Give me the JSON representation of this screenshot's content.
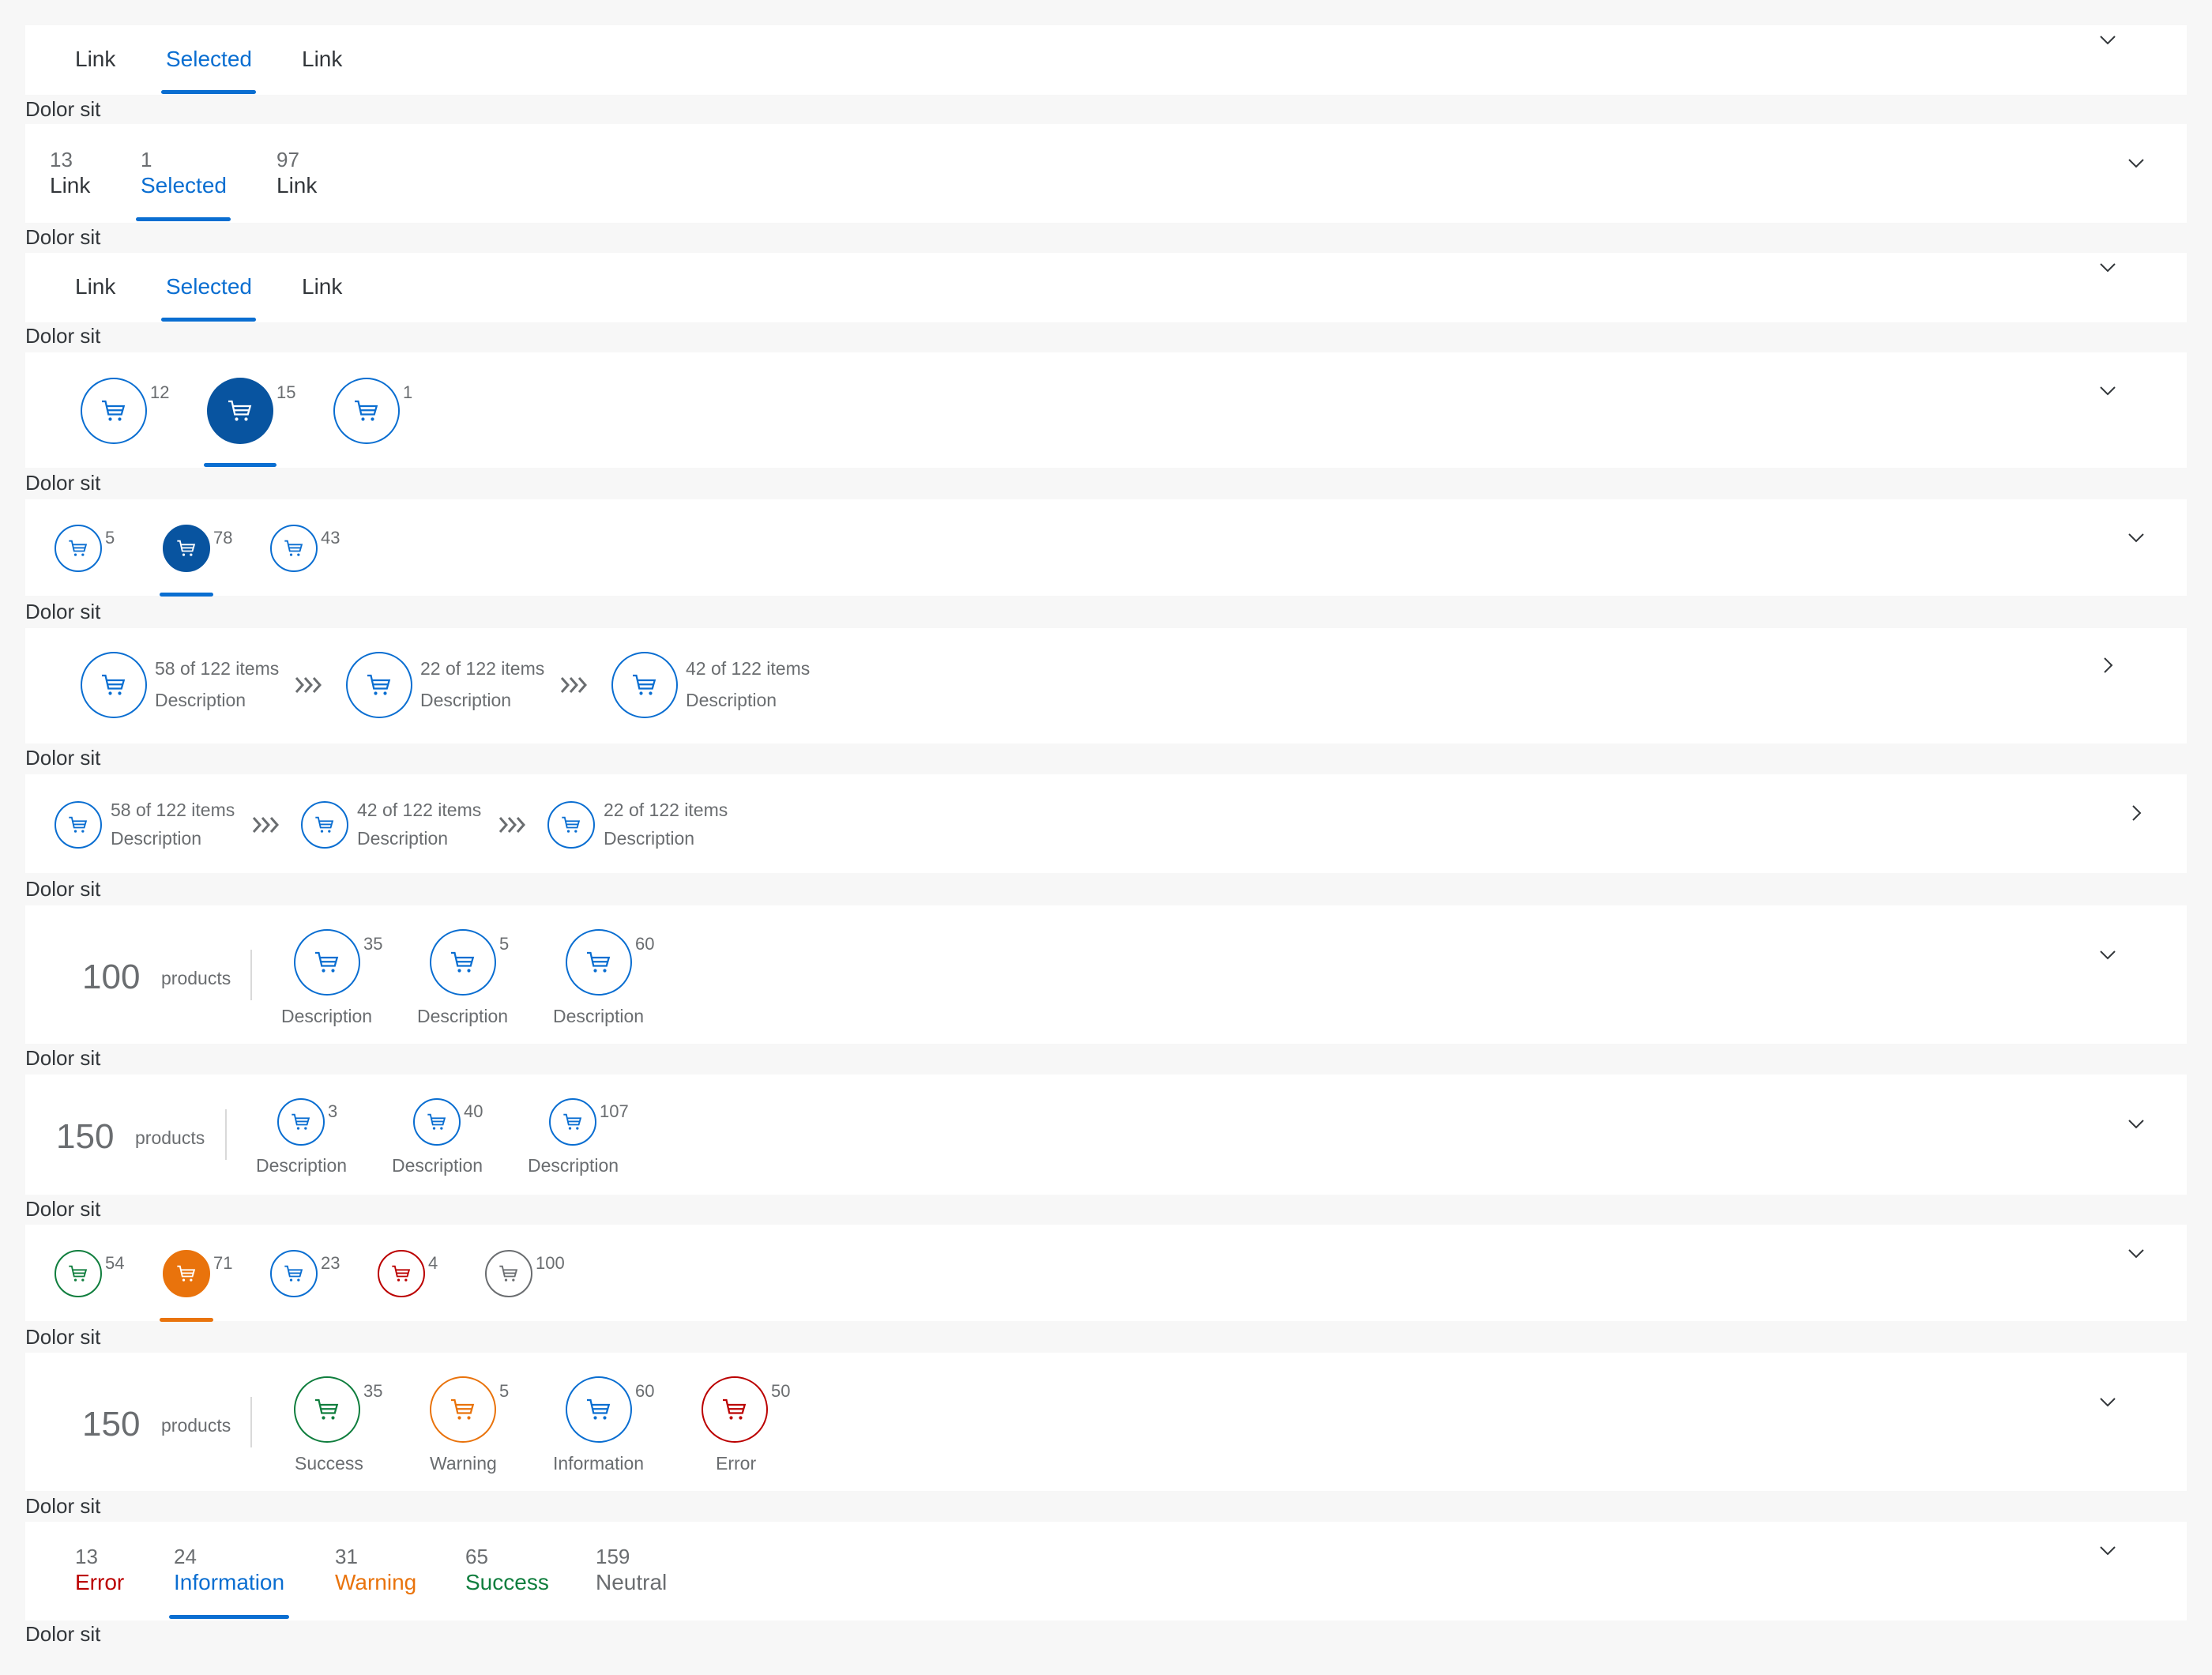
{
  "caption": "Dolor sit",
  "colors": {
    "brand": "#0a6ed1",
    "selected_fill": "#0854a0",
    "success": "#107e3e",
    "warning": "#e9730c",
    "information": "#0a6ed1",
    "error": "#bb0000",
    "neutral": "#6a6d70"
  },
  "icons": {
    "item": "cart-icon",
    "expand": "chevron-down-icon",
    "next": "chevron-right-icon",
    "step": "triple-chevron-icon"
  },
  "row1": {
    "tabs": [
      {
        "label": "Link"
      },
      {
        "label": "Selected"
      },
      {
        "label": "Link"
      }
    ]
  },
  "row2": {
    "tabs": [
      {
        "count": "13",
        "label": "Link"
      },
      {
        "count": "1",
        "label": "Selected"
      },
      {
        "count": "97",
        "label": "Link"
      }
    ]
  },
  "row3": {
    "tabs": [
      {
        "label": "Link"
      },
      {
        "label": "Selected"
      },
      {
        "label": "Link"
      }
    ]
  },
  "row4": {
    "items": [
      {
        "count": "12"
      },
      {
        "count": "15"
      },
      {
        "count": "1"
      }
    ]
  },
  "row5": {
    "items": [
      {
        "count": "5"
      },
      {
        "count": "78"
      },
      {
        "count": "43"
      }
    ]
  },
  "row6": {
    "steps": [
      {
        "line1": "58 of 122 items",
        "line2": "Description"
      },
      {
        "line1": "22 of 122 items",
        "line2": "Description"
      },
      {
        "line1": "42 of 122 items",
        "line2": "Description"
      }
    ]
  },
  "row7": {
    "steps": [
      {
        "line1": "58 of 122 items",
        "line2": "Description"
      },
      {
        "line1": "42 of 122 items",
        "line2": "Description"
      },
      {
        "line1": "22 of 122 items",
        "line2": "Description"
      }
    ]
  },
  "row8": {
    "total": "100",
    "unit": "products",
    "items": [
      {
        "count": "35",
        "label": "Description"
      },
      {
        "count": "5",
        "label": "Description"
      },
      {
        "count": "60",
        "label": "Description"
      }
    ]
  },
  "row9": {
    "total": "150",
    "unit": "products",
    "items": [
      {
        "count": "3",
        "label": "Description"
      },
      {
        "count": "40",
        "label": "Description"
      },
      {
        "count": "107",
        "label": "Description"
      }
    ]
  },
  "row10": {
    "items": [
      {
        "count": "54"
      },
      {
        "count": "71"
      },
      {
        "count": "23"
      },
      {
        "count": "4"
      },
      {
        "count": "100"
      }
    ]
  },
  "row11": {
    "total": "150",
    "unit": "products",
    "items": [
      {
        "count": "35",
        "label": "Success"
      },
      {
        "count": "5",
        "label": "Warning"
      },
      {
        "count": "60",
        "label": "Information"
      },
      {
        "count": "50",
        "label": "Error"
      }
    ]
  },
  "row12": {
    "tabs": [
      {
        "count": "13",
        "label": "Error"
      },
      {
        "count": "24",
        "label": "Information"
      },
      {
        "count": "31",
        "label": "Warning"
      },
      {
        "count": "65",
        "label": "Success"
      },
      {
        "count": "159",
        "label": "Neutral"
      }
    ]
  }
}
